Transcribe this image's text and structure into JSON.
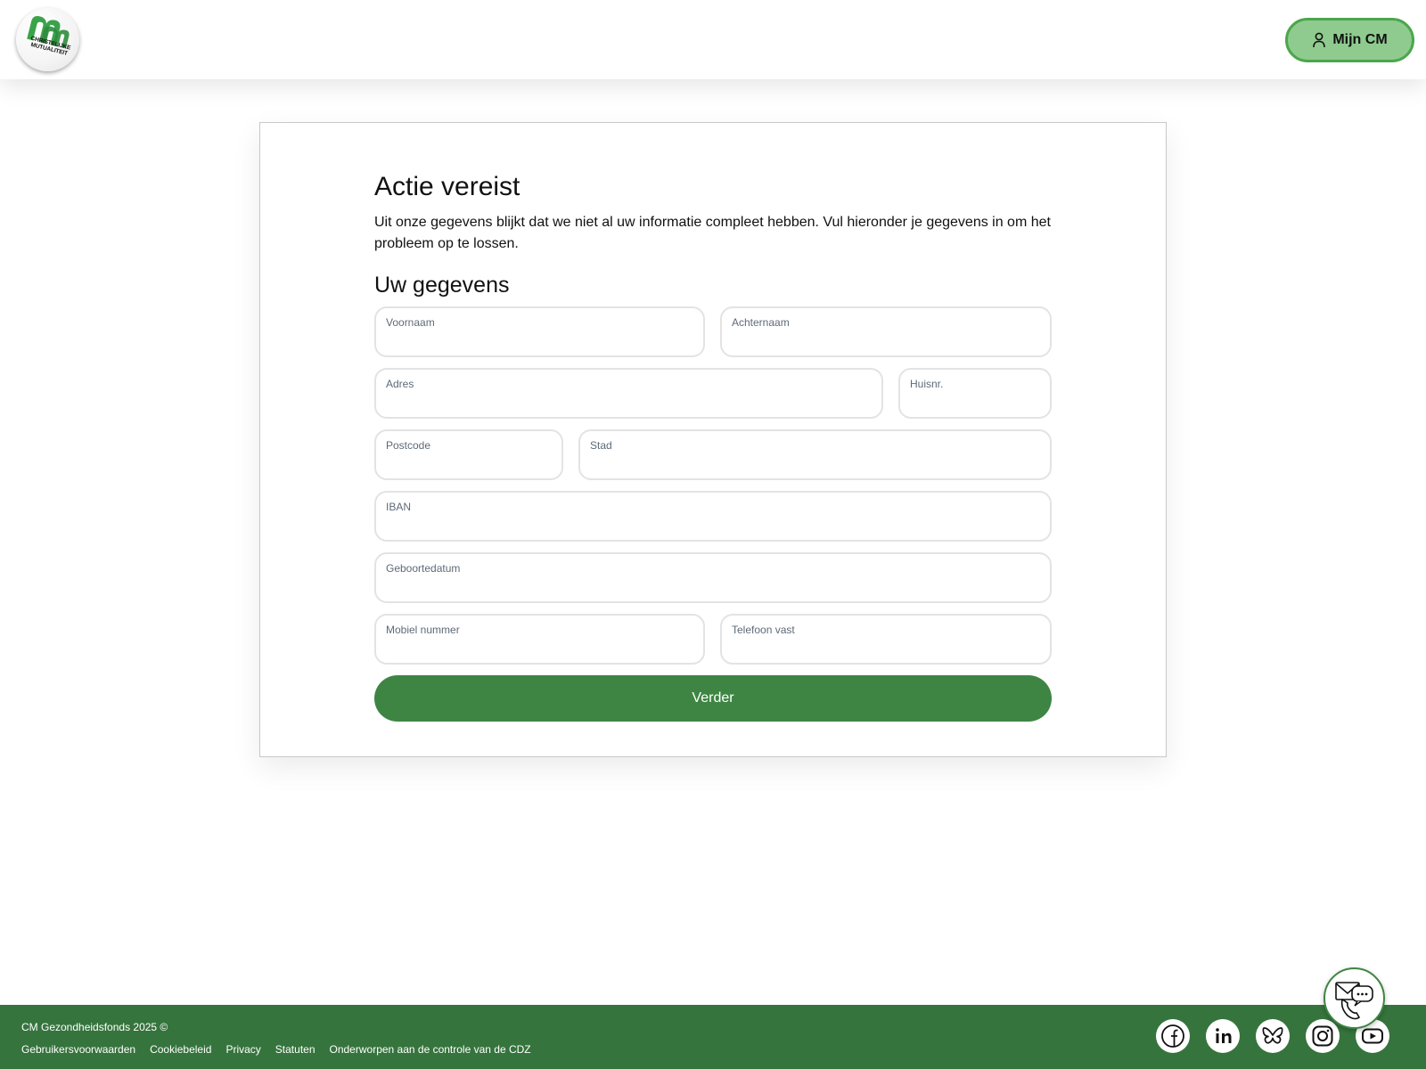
{
  "header": {
    "logo_text_line1": "CHRISTELIJKE",
    "logo_text_line2": "MUTUALITEIT",
    "account_button_label": "Mijn CM"
  },
  "form": {
    "title": "Actie vereist",
    "intro": "Uit onze gegevens blijkt dat we niet al uw informatie compleet hebben. Vul hieronder je gegevens in om het probleem op te lossen.",
    "section_title": "Uw gegevens",
    "fields": {
      "first_name": {
        "label": "Voornaam",
        "value": ""
      },
      "last_name": {
        "label": "Achternaam",
        "value": ""
      },
      "address": {
        "label": "Adres",
        "value": ""
      },
      "house_number": {
        "label": "Huisnr.",
        "value": ""
      },
      "postcode": {
        "label": "Postcode",
        "value": ""
      },
      "city": {
        "label": "Stad",
        "value": ""
      },
      "iban": {
        "label": "IBAN",
        "value": ""
      },
      "birth_date": {
        "label": "Geboortedatum",
        "value": ""
      },
      "mobile": {
        "label": "Mobiel nummer",
        "value": ""
      },
      "landline": {
        "label": "Telefoon vast",
        "value": ""
      }
    },
    "submit_label": "Verder"
  },
  "footer": {
    "copyright": "CM Gezondheidsfonds 2025 ©",
    "links": [
      "Gebruikersvoorwaarden",
      "Cookiebeleid",
      "Privacy",
      "Statuten",
      "Onderworpen aan de controle van de CDZ"
    ],
    "social": [
      "facebook-icon",
      "linkedin-icon",
      "bluesky-icon",
      "instagram-icon",
      "youtube-icon"
    ]
  },
  "chat": {
    "icon": "mail-phone-chat-icon"
  },
  "colors": {
    "brand_green": "#3e8543",
    "footer_green": "#36743d",
    "account_button_bg": "#8fcb8f",
    "account_button_border": "#4ca64c",
    "logo_green": "#3aa34a"
  }
}
